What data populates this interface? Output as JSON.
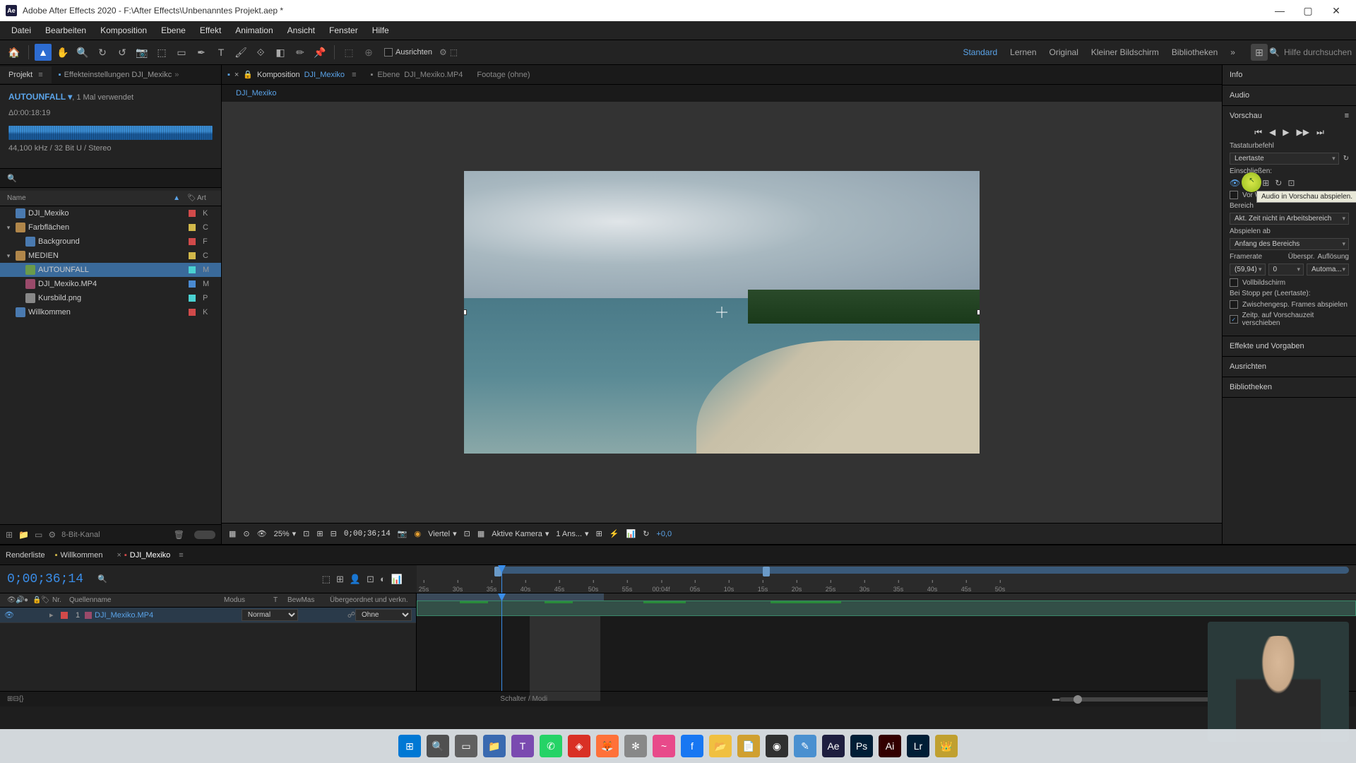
{
  "window": {
    "title": "Adobe After Effects 2020 - F:\\After Effects\\Unbenanntes Projekt.aep *"
  },
  "menu": [
    "Datei",
    "Bearbeiten",
    "Komposition",
    "Ebene",
    "Effekt",
    "Animation",
    "Ansicht",
    "Fenster",
    "Hilfe"
  ],
  "toolbar": {
    "ausrichten": "Ausrichten"
  },
  "workspaces": [
    "Standard",
    "Lernen",
    "Original",
    "Kleiner Bildschirm",
    "Bibliotheken"
  ],
  "search_placeholder": "Hilfe durchsuchen",
  "project": {
    "tab": "Projekt",
    "subtab": "Effekteinstellungen DJI_Mexikc",
    "asset_name": "AUTOUNFALL",
    "asset_usage": ", 1 Mal verwendet",
    "duration": "Δ0:00:18:19",
    "audio_spec": "44,100 kHz / 32 Bit U / Stereo",
    "head_name": "Name",
    "head_art": "Art",
    "items": [
      {
        "indent": 0,
        "twist": "",
        "icon": "ic-comp",
        "label": "DJI_Mexiko",
        "swatch": "#d14a4a",
        "type": "K"
      },
      {
        "indent": 0,
        "twist": "▾",
        "icon": "ic-folder",
        "label": "Farbflächen",
        "swatch": "#d1b84a",
        "type": "C"
      },
      {
        "indent": 1,
        "twist": "",
        "icon": "ic-comp",
        "label": "Background",
        "swatch": "#d14a4a",
        "type": "F"
      },
      {
        "indent": 0,
        "twist": "▾",
        "icon": "ic-folder",
        "label": "MEDIEN",
        "swatch": "#d1b84a",
        "type": "C"
      },
      {
        "indent": 1,
        "twist": "",
        "icon": "ic-audio",
        "label": "AUTOUNFALL",
        "swatch": "#4ad1d1",
        "type": "M",
        "selected": true
      },
      {
        "indent": 1,
        "twist": "",
        "icon": "ic-video",
        "label": "DJI_Mexiko.MP4",
        "swatch": "#4a8ad1",
        "type": "M"
      },
      {
        "indent": 1,
        "twist": "",
        "icon": "ic-img",
        "label": "Kursbild.png",
        "swatch": "#4ad1d1",
        "type": "P"
      },
      {
        "indent": 0,
        "twist": "",
        "icon": "ic-comp",
        "label": "Willkommen",
        "swatch": "#d14a4a",
        "type": "K"
      }
    ],
    "footer_depth": "8-Bit-Kanal"
  },
  "viewer": {
    "tabs": {
      "comp_prefix": "Komposition ",
      "comp_name": "DJI_Mexiko",
      "layer_prefix": "Ebene ",
      "layer_name": "DJI_Mexiko.MP4",
      "footage": "Footage (ohne)"
    },
    "breadcrumb": "DJI_Mexiko",
    "footer": {
      "zoom": "25%",
      "time": "0;00;36;14",
      "res": "Viertel",
      "camera": "Aktive Kamera",
      "views": "1 Ans...",
      "exposure": "+0,0"
    }
  },
  "right": {
    "info": "Info",
    "audio": "Audio",
    "vorschau": "Vorschau",
    "tastatur": "Tastaturbefehl",
    "leertaste": "Leertaste",
    "einschliessen": "Einschließen:",
    "vor_wiederg": "Vor Wi",
    "tooltip": "Audio in Vorschau abspielen.",
    "bereich": "Bereich",
    "bereich_val": "Akt. Zeit nicht in Arbeitsbereich",
    "abspielen": "Abspielen ab",
    "abspielen_val": "Anfang des Bereichs",
    "framerate": "Framerate",
    "ueberspr": "Überspr.",
    "aufloesung": "Auflösung",
    "fr_val": "(59,94)",
    "skip_val": "0",
    "res_val": "Automa...",
    "vollbild": "Vollbildschirm",
    "stopp": "Bei Stopp per (Leertaste):",
    "zwischen": "Zwischengesp. Frames abspielen",
    "zeitp": "Zeitp. auf Vorschauzeit verschieben",
    "effekte": "Effekte und Vorgaben",
    "ausrichten": "Ausrichten",
    "biblio": "Bibliotheken"
  },
  "timeline": {
    "tabs": {
      "render": "Renderliste",
      "willkommen": "Willkommen",
      "comp": "DJI_Mexiko"
    },
    "timecode": "0;00;36;14",
    "ticks": [
      "25s",
      "30s",
      "35s",
      "40s",
      "45s",
      "50s",
      "55s",
      "00:04f",
      "05s",
      "10s",
      "15s",
      "20s",
      "25s",
      "30s",
      "35s",
      "40s",
      "45s",
      "50s"
    ],
    "head": {
      "nr": "Nr.",
      "quelle": "Quellenname",
      "modus": "Modus",
      "t": "T",
      "bewmas": "BewMas",
      "ueber": "Übergeordnet und verkn."
    },
    "layer": {
      "num": "1",
      "name": "DJI_Mexiko.MP4",
      "mode": "Normal",
      "parent": "Ohne"
    },
    "footer": "Schalter / Modi"
  },
  "taskbar_icons": [
    {
      "bg": "#0078d4",
      "glyph": "⊞"
    },
    {
      "bg": "#505050",
      "glyph": "🔍"
    },
    {
      "bg": "#606060",
      "glyph": "▭"
    },
    {
      "bg": "#3a6ab0",
      "glyph": "📁"
    },
    {
      "bg": "#7a4ab0",
      "glyph": "T"
    },
    {
      "bg": "#25d366",
      "glyph": "✆"
    },
    {
      "bg": "#d93025",
      "glyph": "◈"
    },
    {
      "bg": "#ff7139",
      "glyph": "🦊"
    },
    {
      "bg": "#888",
      "glyph": "✻"
    },
    {
      "bg": "#e84a8a",
      "glyph": "~"
    },
    {
      "bg": "#1877f2",
      "glyph": "f"
    },
    {
      "bg": "#f0c040",
      "glyph": "📂"
    },
    {
      "bg": "#d0a030",
      "glyph": "📄"
    },
    {
      "bg": "#303030",
      "glyph": "◉"
    },
    {
      "bg": "#4a90d0",
      "glyph": "✎"
    },
    {
      "bg": "#1e1e3f",
      "glyph": "Ae"
    },
    {
      "bg": "#001e36",
      "glyph": "Ps"
    },
    {
      "bg": "#330000",
      "glyph": "Ai"
    },
    {
      "bg": "#001e36",
      "glyph": "Lr"
    },
    {
      "bg": "#c0a030",
      "glyph": "👑"
    }
  ]
}
